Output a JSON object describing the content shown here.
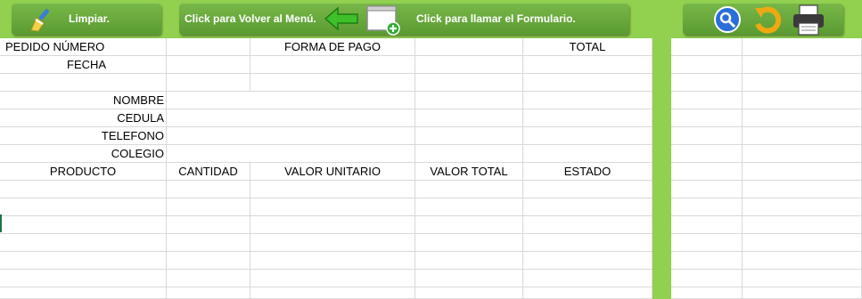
{
  "toolbar": {
    "clear_label": "Limpiar.",
    "menu_label": "Click para Volver al Menú.",
    "form_label": "Click para llamar el Formulario.",
    "icons": [
      "broom-icon",
      "green-arrow-left-icon",
      "window-add-icon",
      "search-icon",
      "refresh-icon",
      "printer-icon"
    ]
  },
  "sheet": {
    "pedido_numero": "PEDIDO NÚMERO",
    "forma_pago": "FORMA DE PAGO",
    "total": "TOTAL",
    "fecha": "FECHA",
    "nombre": "NOMBRE",
    "cedula": "CEDULA",
    "telefono": "TELEFONO",
    "colegio": "COLEGIO",
    "columns": [
      "PRODUCTO",
      "CANTIDAD",
      "VALOR UNITARIO",
      "VALOR TOTAL",
      "ESTADO"
    ]
  },
  "colors": {
    "accent": "#92d050",
    "button": "#6aaa3a",
    "grid": "#d9d9d9"
  }
}
